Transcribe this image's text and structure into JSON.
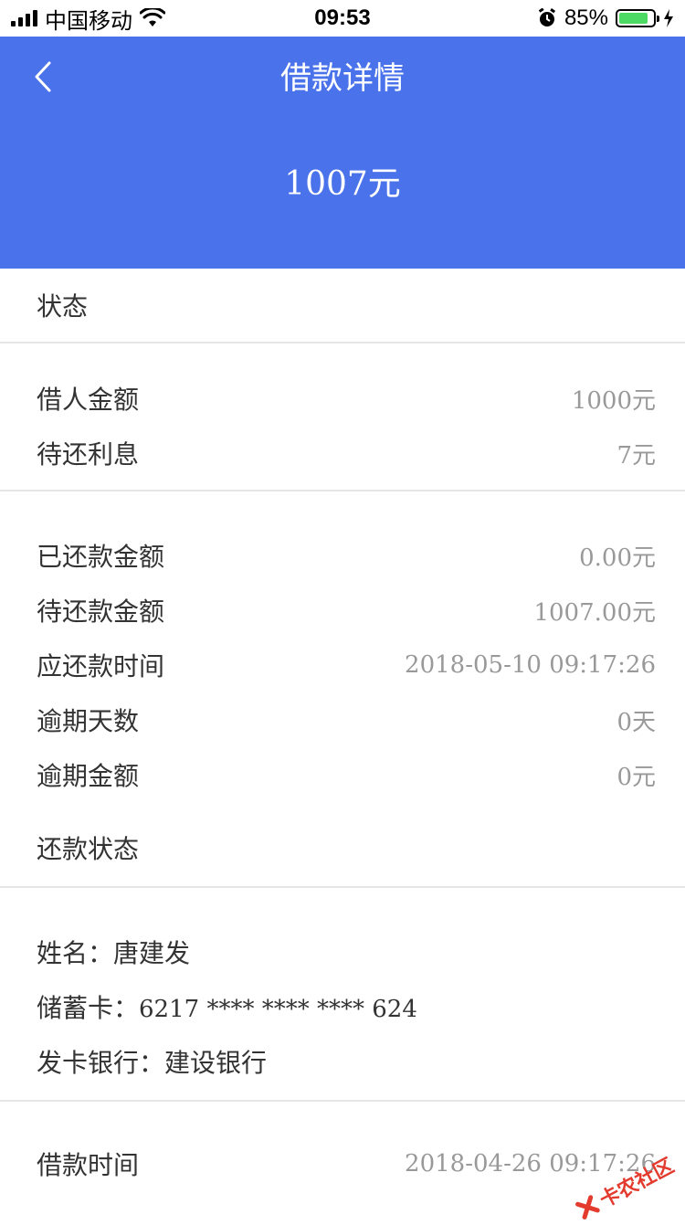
{
  "status_bar": {
    "carrier": "中国移动",
    "time": "09:53",
    "battery": "85%",
    "battery_level": 0.85
  },
  "header": {
    "title": "借款详情",
    "amount": "1007元",
    "color": "#4a72ea"
  },
  "status_section": {
    "label": "状态"
  },
  "loan": {
    "principal_label": "借人金额",
    "principal_value": "1000元",
    "interest_label": "待还利息",
    "interest_value": "7元"
  },
  "repayment": {
    "repaid_label": "已还款金额",
    "repaid_value": "0.00元",
    "pending_label": "待还款金额",
    "pending_value": "1007.00元",
    "due_label": "应还款时间",
    "due_value": "2018-05-10 09:17:26",
    "overdue_days_label": "逾期天数",
    "overdue_days_value": "0天",
    "overdue_amount_label": "逾期金额",
    "overdue_amount_value": "0元",
    "status_label": "还款状态"
  },
  "account": {
    "name_label": "姓名：",
    "name_value": "唐建发",
    "card_label": "储蓄卡：",
    "card_value": "6217 **** **** **** 624",
    "bank_label": "发卡银行：",
    "bank_value": "建设银行"
  },
  "loan_time": {
    "label": "借款时间",
    "value": "2018-04-26 09:17:26"
  },
  "watermark": {
    "text": "卡农社区"
  }
}
